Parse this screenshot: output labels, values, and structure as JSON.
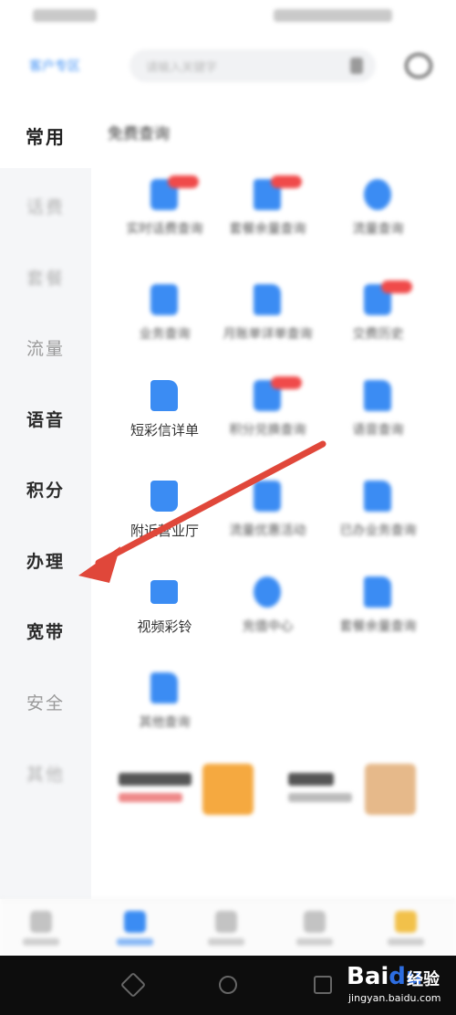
{
  "header": {
    "city": "客户专区",
    "search_placeholder": "请输入关键字"
  },
  "sidebar": {
    "items": [
      {
        "label": "常用",
        "style": "selected"
      },
      {
        "label": "话费",
        "style": "faint"
      },
      {
        "label": "套餐",
        "style": "faint"
      },
      {
        "label": "流量",
        "style": "normal"
      },
      {
        "label": "语音",
        "style": "strong"
      },
      {
        "label": "积分",
        "style": "strong"
      },
      {
        "label": "办理",
        "style": "strong"
      },
      {
        "label": "宽带",
        "style": "strong"
      },
      {
        "label": "安全",
        "style": "normal"
      },
      {
        "label": "其他",
        "style": "faint"
      }
    ]
  },
  "main": {
    "section_title": "免费查询",
    "tiles": [
      {
        "label": "实时话费查询",
        "icon": "wallet-icon",
        "badge": true,
        "clear": false
      },
      {
        "label": "套餐余量查询",
        "icon": "document-icon",
        "badge": true,
        "clear": false
      },
      {
        "label": "流量查询",
        "icon": "circle-icon",
        "badge": false,
        "clear": false
      },
      {
        "label": "业务查询",
        "icon": "bag-icon",
        "badge": false,
        "clear": false
      },
      {
        "label": "月账单详单查询",
        "icon": "document-icon",
        "badge": false,
        "clear": false
      },
      {
        "label": "交费历史",
        "icon": "phone-icon",
        "badge": true,
        "clear": false
      },
      {
        "label": "短彩信详单",
        "icon": "sms-detail-icon",
        "badge": false,
        "clear": true
      },
      {
        "label": "积分兑换查询",
        "icon": "chart-icon",
        "badge": true,
        "clear": false
      },
      {
        "label": "语音查询",
        "icon": "document-icon",
        "badge": false,
        "clear": false
      },
      {
        "label": "附近营业厅",
        "icon": "store-icon",
        "badge": false,
        "clear": true
      },
      {
        "label": "流量优惠活动",
        "icon": "monitor-icon",
        "badge": false,
        "clear": false
      },
      {
        "label": "已办业务查询",
        "icon": "document-icon",
        "badge": false,
        "clear": false
      },
      {
        "label": "视频彩铃",
        "icon": "video-ringtone-icon",
        "badge": false,
        "clear": true
      },
      {
        "label": "充值中心",
        "icon": "heart-icon",
        "badge": false,
        "clear": false
      },
      {
        "label": "套餐余量查询",
        "icon": "document-icon",
        "badge": false,
        "clear": false
      },
      {
        "label": "其他查询",
        "icon": "document-icon",
        "badge": false,
        "clear": false
      }
    ]
  },
  "watermark": {
    "logo_bai": "Bai",
    "logo_du": "du",
    "logo_jingyan": "经验",
    "url": "jingyan.baidu.com"
  },
  "colors": {
    "accent": "#3b8cf3",
    "arrow": "#e0473a",
    "badge": "#f04a4a"
  }
}
